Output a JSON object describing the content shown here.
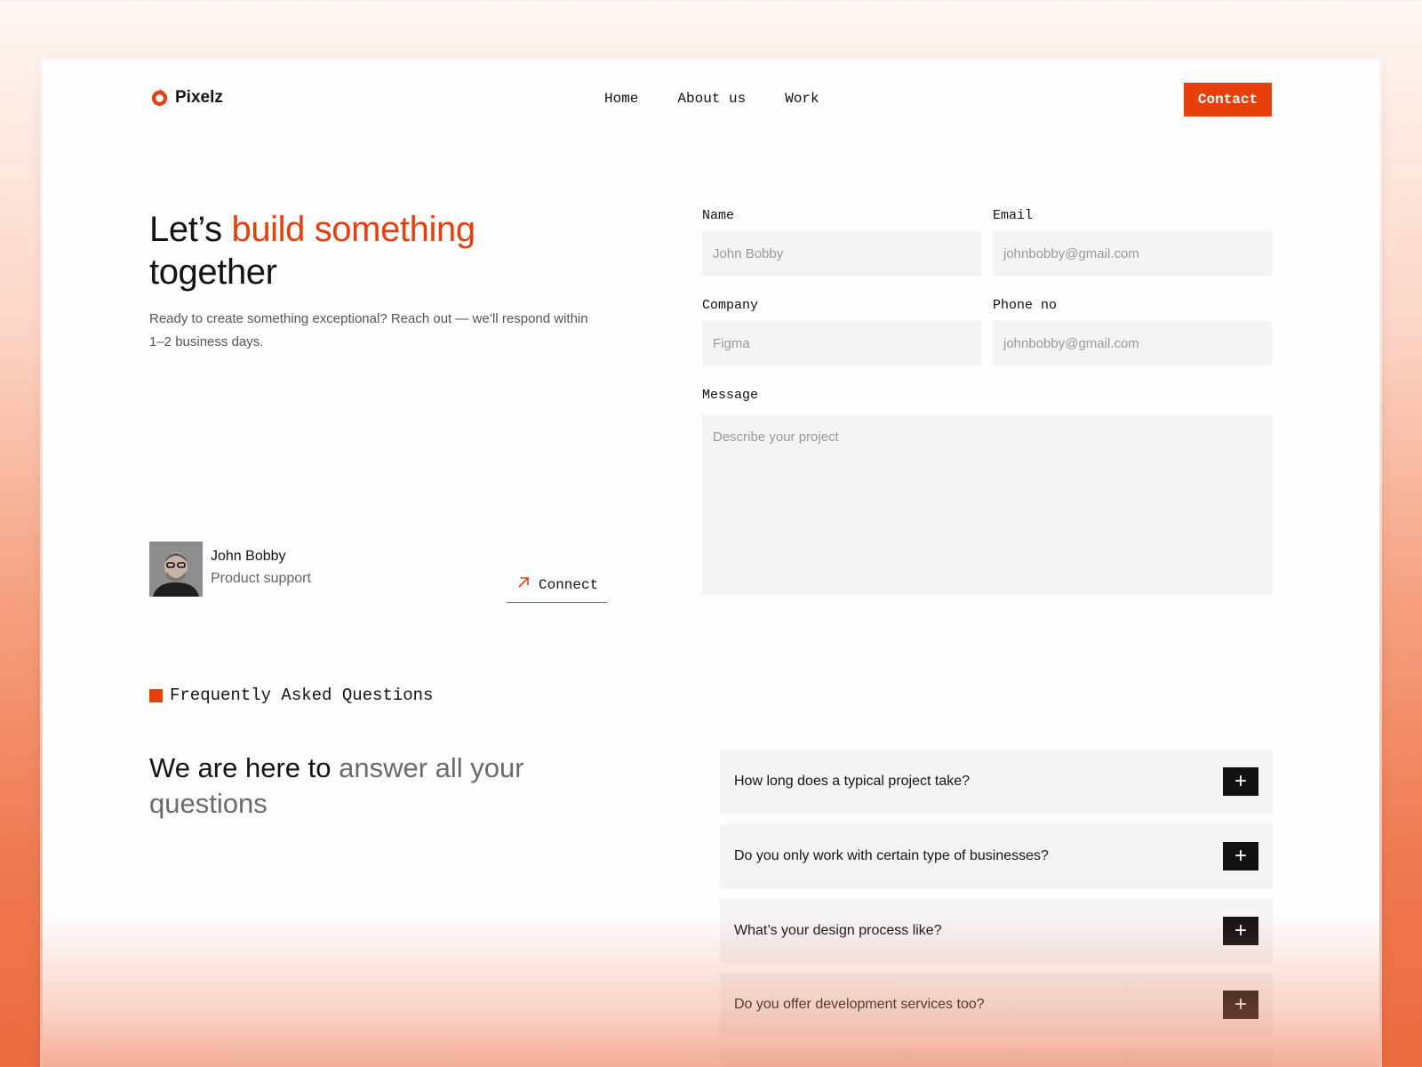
{
  "brand": {
    "name": "Pixelz",
    "accent": "#e8400c"
  },
  "nav": {
    "items": [
      "Home",
      "About us",
      "Work"
    ],
    "contact_label": "Contact"
  },
  "hero": {
    "title_start": "Let’s ",
    "title_accent": "build something",
    "title_end": "together",
    "subtitle": "Ready to create something exceptional? Reach out — we’ll respond within 1–2 business days."
  },
  "person": {
    "name": "John Bobby",
    "role": "Product support",
    "connect_label": "Connect"
  },
  "form": {
    "name": {
      "label": "Name",
      "placeholder": "John Bobby"
    },
    "email": {
      "label": "Email",
      "placeholder": "johnbobby@gmail.com"
    },
    "company": {
      "label": "Company",
      "placeholder": "Figma"
    },
    "phone": {
      "label": "Phone no",
      "placeholder": "johnbobby@gmail.com"
    },
    "message": {
      "label": "Message",
      "placeholder": "Describe your project"
    }
  },
  "faq": {
    "tag": "Frequently Asked Questions",
    "title_start": "We are here to ",
    "title_muted": "answer all your questions",
    "items": [
      {
        "question": "How long does a typical project take?"
      },
      {
        "question": "Do you only work with certain type of businesses?"
      },
      {
        "question": "What’s your design process like?"
      },
      {
        "question": "Do you offer development services too?"
      }
    ]
  }
}
